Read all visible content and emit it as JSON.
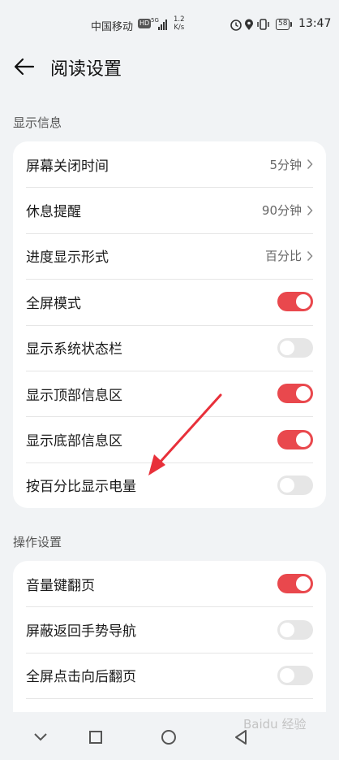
{
  "status_bar": {
    "carrier": "中国移动",
    "hd_badge": "HD",
    "network": "5G",
    "speed_value": "1.2",
    "speed_unit": "K/s",
    "battery": "58",
    "time": "13:47"
  },
  "header": {
    "back_icon": "arrow-left-icon",
    "title": "阅读设置"
  },
  "sections": [
    {
      "label": "显示信息",
      "rows": [
        {
          "label": "屏幕关闭时间",
          "value": "5分钟",
          "control": "chevron"
        },
        {
          "label": "休息提醒",
          "value": "90分钟",
          "control": "chevron"
        },
        {
          "label": "进度显示形式",
          "value": "百分比",
          "control": "chevron"
        },
        {
          "label": "全屏模式",
          "control": "toggle",
          "on": true
        },
        {
          "label": "显示系统状态栏",
          "control": "toggle",
          "on": false
        },
        {
          "label": "显示顶部信息区",
          "control": "toggle",
          "on": true
        },
        {
          "label": "显示底部信息区",
          "control": "toggle",
          "on": true
        },
        {
          "label": "按百分比显示电量",
          "control": "toggle",
          "on": false
        }
      ]
    },
    {
      "label": "操作设置",
      "rows": [
        {
          "label": "音量键翻页",
          "control": "toggle",
          "on": true
        },
        {
          "label": "屏蔽返回手势导航",
          "control": "toggle",
          "on": false
        },
        {
          "label": "全屏点击向后翻页",
          "control": "toggle",
          "on": false
        }
      ]
    }
  ],
  "nav_bar": {
    "buttons": [
      "chevron-down-icon",
      "square-icon",
      "circle-icon",
      "triangle-back-icon"
    ]
  },
  "colors": {
    "accent": "#e9484d",
    "background": "#f1f3f5",
    "card": "#ffffff",
    "annotation_arrow": "#e8303a"
  },
  "watermark": "Baidu 经验"
}
